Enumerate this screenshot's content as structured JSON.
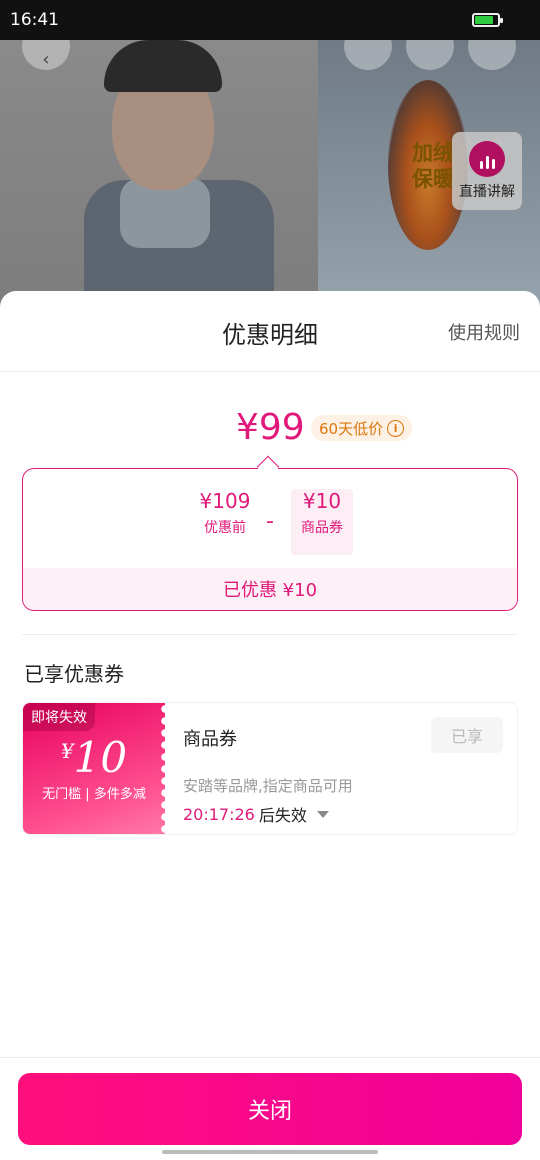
{
  "status_bar": {
    "time": "16:41"
  },
  "background": {
    "flame_text": "加绒\n保暖",
    "live_label": "直播讲解"
  },
  "sheet": {
    "title": "优惠明细",
    "rules_link": "使用规则",
    "final_price": "¥99",
    "low_price_badge": "60天低价",
    "calculation": {
      "original_price": "¥109",
      "original_label": "优惠前",
      "operator": "-",
      "discount_value": "¥10",
      "discount_label": "商品券",
      "saved_text": "已优惠 ¥10"
    },
    "section_title": "已享优惠券",
    "coupon": {
      "expire_tag": "即将失效",
      "currency": "¥",
      "amount": "10",
      "condition": "无门槛 | 多件多减",
      "name": "商品券",
      "status_button": "已享",
      "description": "安踏等品牌,指定商品可用",
      "countdown": "20:17:26",
      "expire_suffix": "后失效"
    },
    "close_button": "关闭"
  },
  "colors": {
    "accent": "#e0197a",
    "badge_text": "#d9780f",
    "badge_bg": "#fdf0e4"
  }
}
